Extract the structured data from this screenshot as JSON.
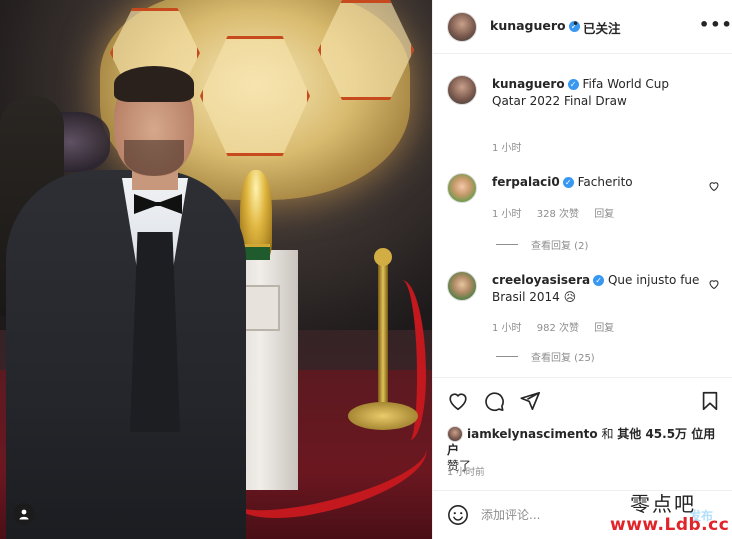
{
  "post": {
    "username": "kunaguero",
    "follow_status": "已关注",
    "separator": "•",
    "more": "•••",
    "caption_user": "kunaguero",
    "caption_text": "Fifa World Cup Qatar 2022 Final Draw",
    "caption_time": "1 小时"
  },
  "comments": [
    {
      "user": "ferpalaci0",
      "text": "Facherito",
      "time": "1 小时",
      "likes": "328 次赞",
      "reply": "回复",
      "view_replies": "查看回复 (2)"
    },
    {
      "user": "creeloyasisera",
      "text": "Que injusto fue Brasil 2014 😥",
      "time": "1 小时",
      "likes": "982 次赞",
      "reply": "回复",
      "view_replies": "查看回复 (25)"
    }
  ],
  "likes_line": {
    "user": "iamkelynascimento",
    "middle": " 和 ",
    "others": "其他 45.5万 位用户",
    "tail": "赞了"
  },
  "posted_time": "1 小时前",
  "comment_box": {
    "placeholder": "添加评论...",
    "post_label": "发布"
  },
  "watermark": {
    "line1": "零点吧",
    "line2": "www.Ldb.cc"
  },
  "colors": {
    "verified": "#3897f0",
    "post_button": "#b2dffc",
    "watermark_red": "#e0242a"
  },
  "icons": [
    "heart-icon",
    "comment-icon",
    "share-icon",
    "bookmark-icon",
    "emoji-icon",
    "user-tag-icon",
    "verified-icon",
    "more-icon"
  ]
}
